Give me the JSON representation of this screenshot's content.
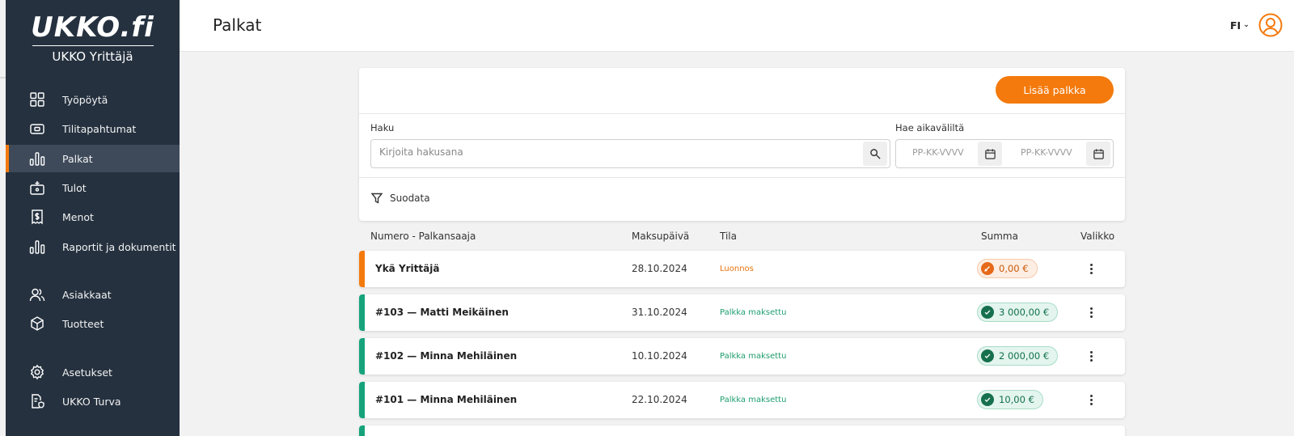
{
  "app": {
    "logo_text": "UKKO.fi",
    "logo_subtitle": "UKKO Yrittäjä"
  },
  "sidebar": {
    "items": [
      {
        "label": "Työpöytä",
        "icon": "grid-icon"
      },
      {
        "label": "Tilitapahtumat",
        "icon": "wallet-icon"
      },
      {
        "label": "Palkat",
        "icon": "bar-chart-icon",
        "active": true
      },
      {
        "label": "Tulot",
        "icon": "cash-register-icon"
      },
      {
        "label": "Menot",
        "icon": "receipt-icon"
      },
      {
        "label": "Raportit ja dokumentit",
        "icon": "report-chart-icon"
      },
      {
        "label": "Asiakkaat",
        "icon": "users-icon"
      },
      {
        "label": "Tuotteet",
        "icon": "box-icon"
      },
      {
        "label": "Asetukset",
        "icon": "settings-icon"
      },
      {
        "label": "UKKO Turva",
        "icon": "shield-document-icon"
      }
    ]
  },
  "header": {
    "title": "Palkat",
    "language": "FI"
  },
  "filters": {
    "add_button_label": "Lisää palkka",
    "search_label": "Haku",
    "search_placeholder": "Kirjoita hakusana",
    "date_range_label": "Hae aikaväliltä",
    "date_start_placeholder": "PP-KK-VVVV",
    "date_end_placeholder": "PP-KK-VVVV",
    "filter_toggle_label": "Suodata"
  },
  "table": {
    "columns": {
      "number_recipient": "Numero - Palkansaaja",
      "payment_date": "Maksupäivä",
      "status": "Tila",
      "amount": "Summa",
      "menu": "Valikko"
    },
    "rows": [
      {
        "name": "Ykä Yrittäjä",
        "date": "28.10.2024",
        "status": "Luonnos",
        "amount": "0,00 €",
        "state": "draft"
      },
      {
        "name": "#103 — Matti Meikäinen",
        "date": "31.10.2024",
        "status": "Palkka maksettu",
        "amount": "3 000,00 €",
        "state": "paid"
      },
      {
        "name": "#102 — Minna Mehiläinen",
        "date": "10.10.2024",
        "status": "Palkka maksettu",
        "amount": "2 000,00 €",
        "state": "paid"
      },
      {
        "name": "#101 — Minna Mehiläinen",
        "date": "22.10.2024",
        "status": "Palkka maksettu",
        "amount": "10,00 €",
        "state": "paid"
      }
    ]
  },
  "colors": {
    "sidebar_bg": "#25313f",
    "accent_orange": "#f47a0d",
    "paid_green": "#16a37b",
    "paid_text": "#1e9e6e",
    "draft_text": "#e8740c"
  }
}
